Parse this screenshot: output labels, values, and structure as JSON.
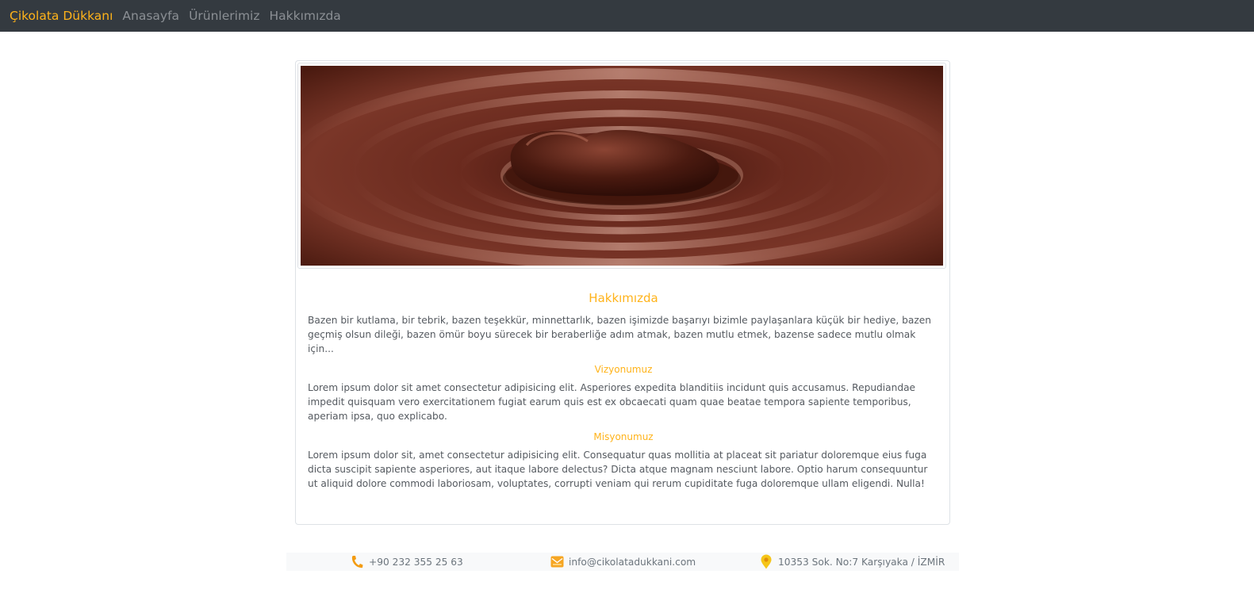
{
  "navbar": {
    "brand": "Çikolata Dükkanı",
    "links": [
      "Anasayfa",
      "Ürünlerimiz",
      "Hakkımızda"
    ]
  },
  "about": {
    "title": "Hakkımızda",
    "intro": "Bazen bir kutlama, bir tebrik, bazen teşekkür, minnettarlık, bazen işimizde başarıyı bizimle paylaşanlara küçük bir hediye, bazen geçmiş olsun dileği, bazen ömür boyu sürecek bir beraberliğe adım atmak, bazen mutlu etmek, bazense sadece mutlu olmak için...",
    "vision_title": "Vizyonumuz",
    "vision_text": "Lorem ipsum dolor sit amet consectetur adipisicing elit. Asperiores expedita blanditiis incidunt quis accusamus. Repudiandae impedit quisquam vero exercitationem fugiat earum quis est ex obcaecati quam quae beatae tempora sapiente temporibus, aperiam ipsa, quo explicabo.",
    "mission_title": "Misyonumuz",
    "mission_text": "Lorem ipsum dolor sit, amet consectetur adipisicing elit. Consequatur quas mollitia at placeat sit pariatur doloremque eius fuga dicta suscipit sapiente asperiores, aut itaque labore delectus? Dicta atque magnam nesciunt labore. Optio harum consequuntur ut aliquid dolore commodi laboriosam, voluptates, corrupti veniam qui rerum cupiditate fuga doloremque ullam eligendi. Nulla!"
  },
  "footer": {
    "phone": "+90 232 355 25 63",
    "email": "info@cikolatadukkani.com",
    "address": "10353 Sok. No:7 Karşıyaka / İZMİR"
  },
  "icons": {
    "phone": "phone-icon",
    "email": "envelope-icon",
    "location": "map-pin-icon"
  },
  "colors": {
    "accent": "#ffb31a",
    "navbar_bg": "#343a40",
    "chocolate": "#6b2a1f"
  }
}
